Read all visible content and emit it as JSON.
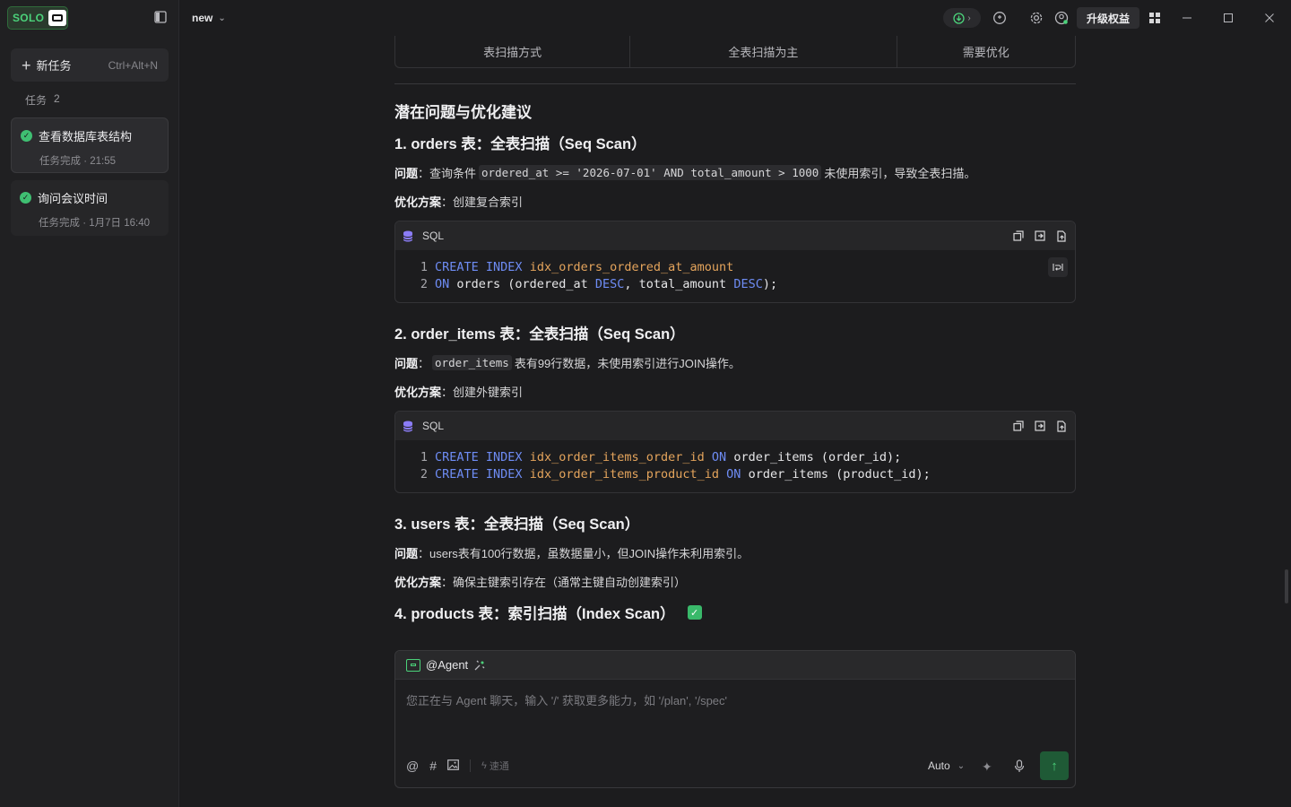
{
  "sidebar": {
    "logo_text": "SOLO",
    "new_task_label": "新任务",
    "new_task_shortcut": "Ctrl+Alt+N",
    "tasks_header": "任务",
    "tasks_count": "2",
    "tasks": [
      {
        "title": "查看数据库表结构",
        "status": "任务完成 · 21:55"
      },
      {
        "title": "询问会议时间",
        "status": "任务完成 · 1月7日 16:40"
      }
    ]
  },
  "topbar": {
    "tab_title": "new",
    "upgrade_label": "升级权益"
  },
  "table_tail": {
    "cells": [
      "表扫描方式",
      "全表扫描为主",
      "需要优化"
    ]
  },
  "article": {
    "section_title": "潜在问题与优化建议",
    "items": [
      {
        "heading": "1. orders 表：全表扫描（Seq Scan）",
        "problem_label": "问题",
        "problem_before": "：查询条件",
        "problem_code": "ordered_at >= '2026-07-01' AND total_amount > 1000",
        "problem_after": "未使用索引，导致全表扫描。",
        "solution_label": "优化方案",
        "solution_text": "：创建复合索引"
      },
      {
        "heading": "2. order_items 表：全表扫描（Seq Scan）",
        "problem_label": "问题",
        "problem_before": "：",
        "problem_code": "order_items",
        "problem_after": "表有99行数据，未使用索引进行JOIN操作。",
        "solution_label": "优化方案",
        "solution_text": "：创建外键索引"
      },
      {
        "heading": "3. users 表：全表扫描（Seq Scan）",
        "problem_label": "问题",
        "problem_text": "：users表有100行数据，虽数据量小，但JOIN操作未利用索引。",
        "solution_label": "优化方案",
        "solution_text": "：确保主键索引存在（通常主键自动创建索引）"
      },
      {
        "heading": "4. products 表：索引扫描（Index Scan）"
      }
    ],
    "code_lang": "SQL",
    "code1": {
      "line1": {
        "n": "1",
        "kw1": "CREATE INDEX",
        "id": "idx_orders_ordered_at_amount"
      },
      "line2": {
        "n": "2",
        "kw1": "ON",
        "p1": "orders (ordered_at",
        "kw2": "DESC",
        "p2": ", total_amount",
        "kw3": "DESC",
        "p3": ");"
      }
    },
    "code2": {
      "line1": {
        "n": "1",
        "kw1": "CREATE INDEX",
        "id": "idx_order_items_order_id",
        "kw2": "ON",
        "p1": "order_items (order_id);"
      },
      "line2": {
        "n": "2",
        "kw1": "CREATE INDEX",
        "id": "idx_order_items_product_id",
        "kw2": "ON",
        "p1": "order_items (product_id);"
      }
    }
  },
  "chat": {
    "agent_label": "@Agent",
    "placeholder": "您正在与 Agent 聊天，输入 '/' 获取更多能力，如 '/plan', '/spec'",
    "speed_label": "速通",
    "mode_label": "Auto"
  },
  "colors": {
    "accent_green": "#4bd27a",
    "keyword_blue": "#6e8cf4",
    "identifier_orange": "#e4a45c",
    "background": "#1c1c1e"
  }
}
